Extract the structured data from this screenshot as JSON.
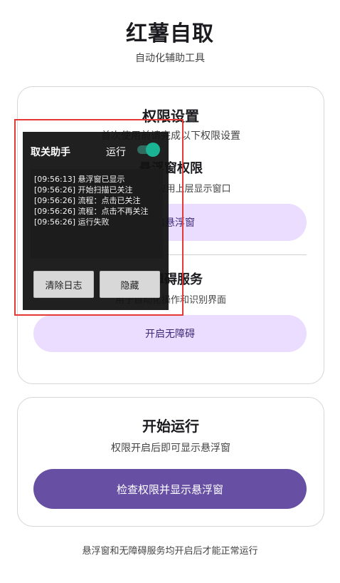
{
  "header": {
    "title": "红薯自取",
    "subtitle": "自动化辅助工具"
  },
  "permissions_card": {
    "title": "权限设置",
    "description": "首次使用前请完成以下权限设置",
    "overlay_section": {
      "title": "悬浮窗权限",
      "description": "允许在其他应用上层显示窗口",
      "button_label": "开启悬浮窗"
    },
    "accessibility_section": {
      "title": "无障碍服务",
      "description": "用于自动化操作和识别界面",
      "button_label": "开启无障碍"
    }
  },
  "run_card": {
    "title": "开始运行",
    "description": "权限开启后即可显示悬浮窗",
    "button_label": "检查权限并显示悬浮窗"
  },
  "footer": {
    "note": "悬浮窗和无障碍服务均开启后才能正常运行"
  },
  "floating_window": {
    "title": "取关助手",
    "run_label": "运行",
    "toggle_on": true,
    "logs": [
      "[09:56:13] 悬浮窗已显示",
      "[09:56:26] 开始扫描已关注",
      "[09:56:26] 流程：点击已关注",
      "[09:56:26] 流程：点击不再关注",
      "[09:56:26] 运行失败"
    ],
    "clear_button_label": "清除日志",
    "hide_button_label": "隐藏"
  },
  "colors": {
    "primary": "#6750a4",
    "primary_container": "#eaddff",
    "toggle_accent": "#1ab394",
    "highlight": "#e53935"
  }
}
